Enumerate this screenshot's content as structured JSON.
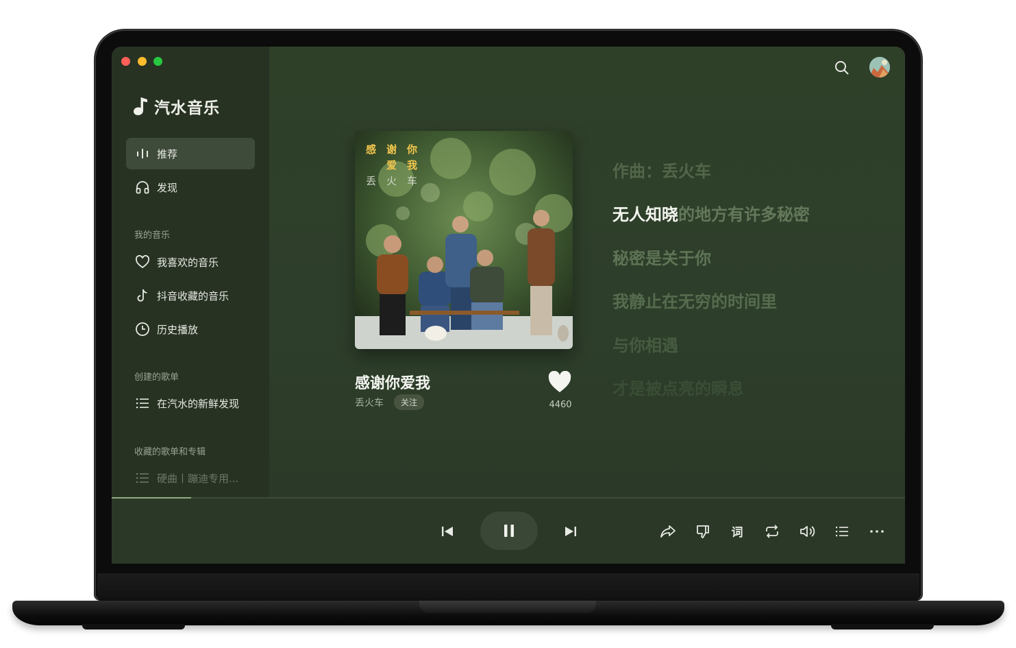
{
  "app": {
    "name": "汽水音乐"
  },
  "colors": {
    "accent": "#8fae7f",
    "background": "#2e3f2b",
    "sidebar": "#273223"
  },
  "sidebar": {
    "primary": [
      {
        "label": "推荐",
        "icon": "equalizer-icon",
        "active": true
      },
      {
        "label": "发现",
        "icon": "headphones-icon",
        "active": false
      }
    ],
    "my_music": {
      "heading": "我的音乐",
      "items": [
        {
          "label": "我喜欢的音乐",
          "icon": "heart-icon"
        },
        {
          "label": "抖音收藏的音乐",
          "icon": "tiktok-icon"
        },
        {
          "label": "历史播放",
          "icon": "clock-icon"
        }
      ]
    },
    "created_playlists": {
      "heading": "创建的歌单",
      "items": [
        {
          "label": "在汽水的新鲜发现",
          "icon": "list-icon"
        }
      ]
    },
    "collected": {
      "heading": "收藏的歌单和专辑",
      "items": [
        {
          "label": "硬曲丨蹦迪专用...",
          "icon": "list-icon"
        }
      ]
    }
  },
  "now_playing": {
    "cover": {
      "title_chars": [
        "感",
        "谢",
        "你",
        "爱",
        "我"
      ],
      "artist_chars": [
        "丢",
        "火",
        "车"
      ]
    },
    "title": "感谢你爱我",
    "artist": "丢火车",
    "follow_label": "关注",
    "like_count": "4460",
    "progress": 0.1
  },
  "lyrics": {
    "composer_line": "作曲：丢火车",
    "current_sung": "无人知晓",
    "current_rest": "的地方有许多秘密",
    "lines": [
      "秘密是关于你",
      "我静止在无穷的时间里",
      "与你相遇",
      "才是被点亮的瞬息"
    ]
  },
  "player_controls": [
    "previous-icon",
    "pause-icon",
    "next-icon",
    "share-icon",
    "dislike-icon",
    "lyrics-icon",
    "repeat-icon",
    "volume-icon",
    "playlist-icon",
    "more-icon"
  ],
  "player_labels": {
    "lyrics_button": "词"
  }
}
